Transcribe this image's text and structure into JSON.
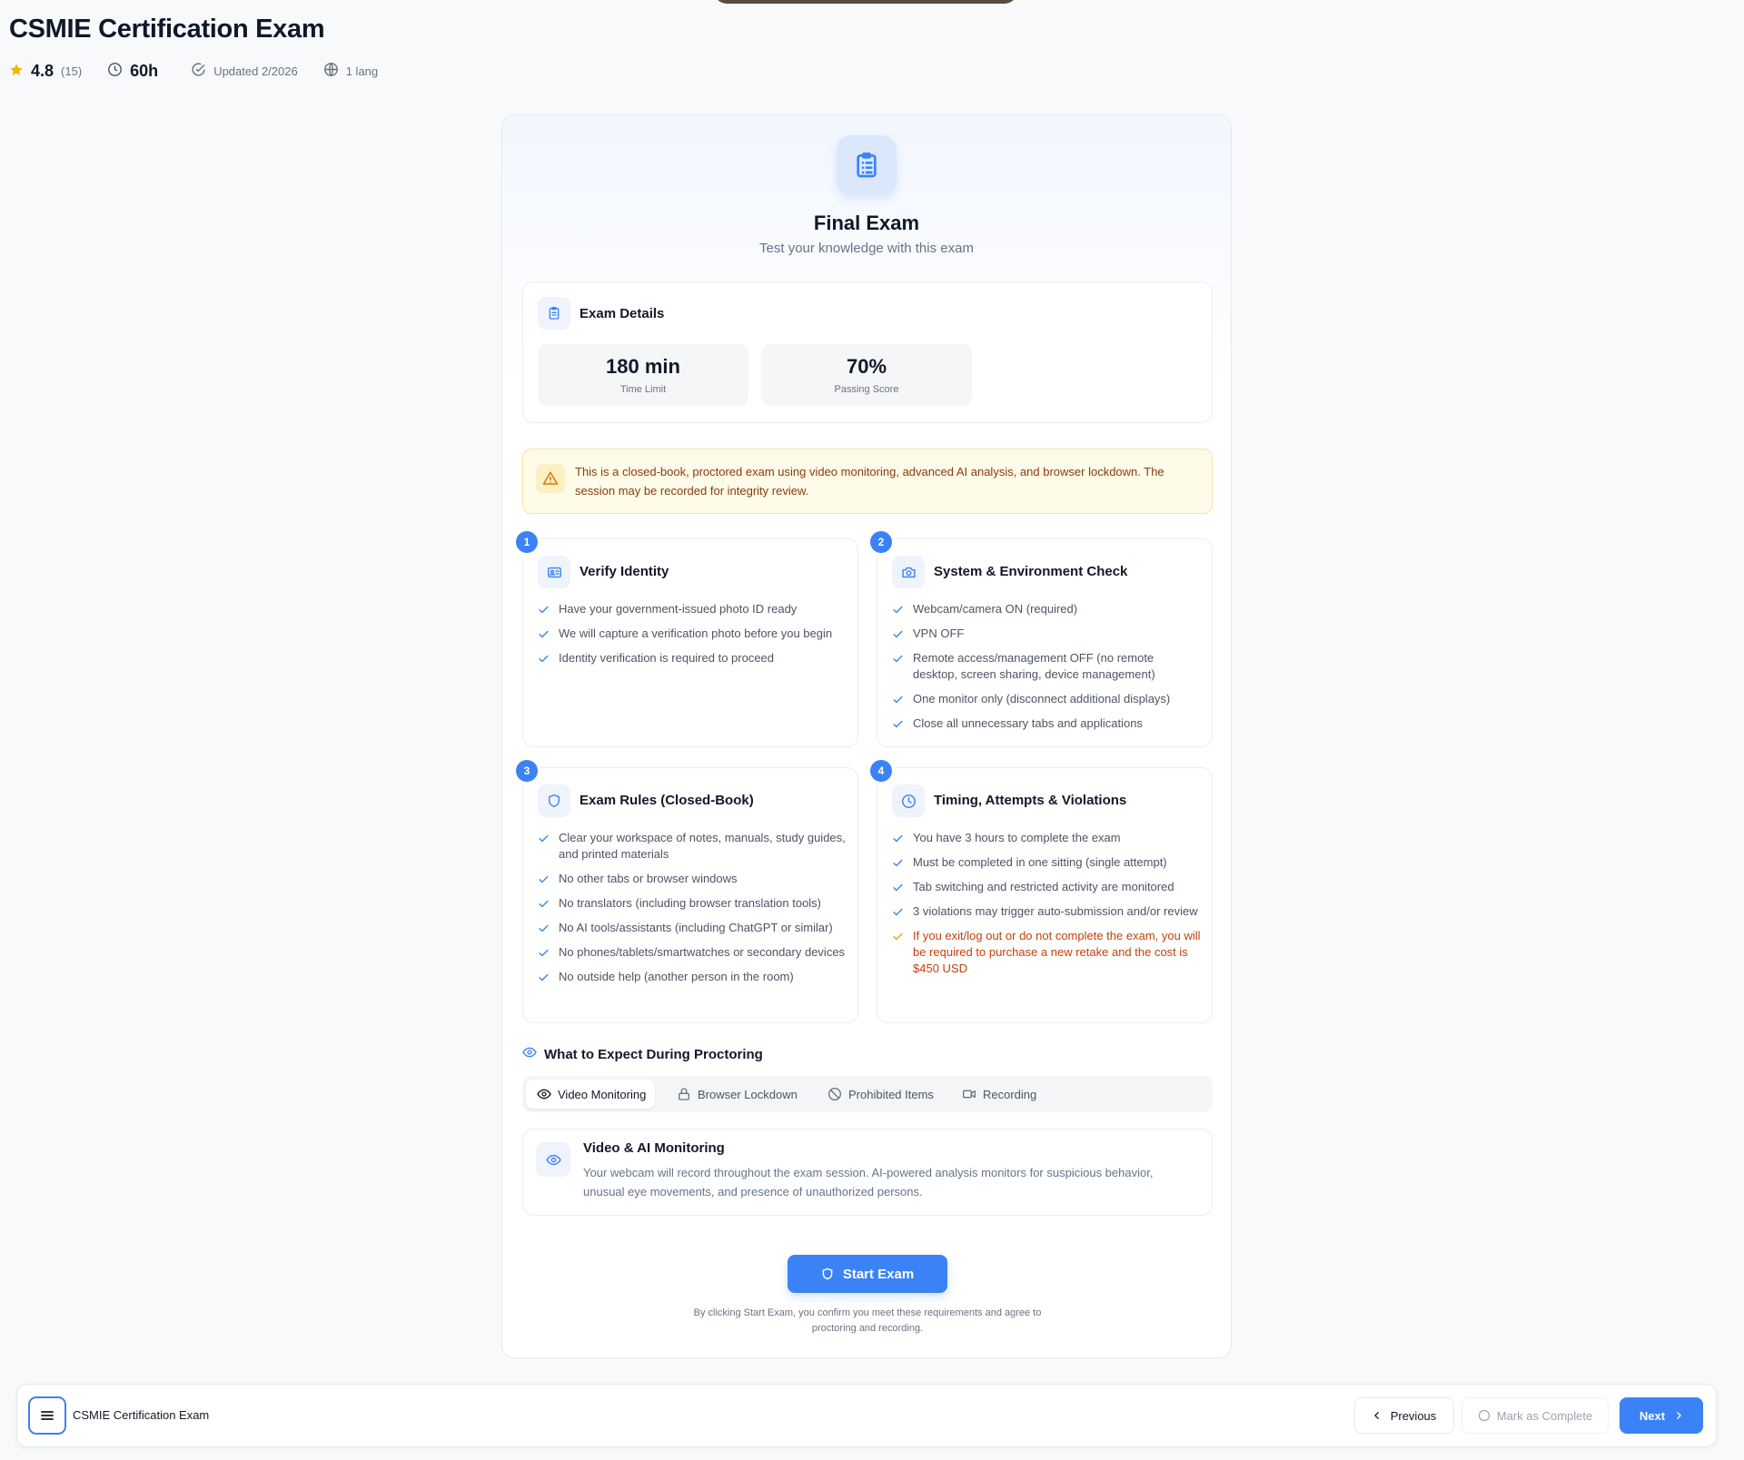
{
  "course": {
    "title": "CSMIE Certification Exam",
    "rating": "4.8",
    "rating_count": "(15)",
    "duration": "60h",
    "updated": "Updated 2/2026",
    "languages": "1 lang"
  },
  "exam": {
    "title": "Final Exam",
    "subtitle": "Test your knowledge with this exam",
    "details": {
      "heading": "Exam Details",
      "time_value": "180 min",
      "time_label": "Time Limit",
      "pass_value": "70%",
      "pass_label": "Passing Score"
    },
    "warning": "This is a closed-book, proctored exam using video monitoring, advanced AI analysis, and browser lockdown. The session may be recorded for integrity review.",
    "steps": [
      {
        "number": "1",
        "title": "Verify Identity",
        "items": [
          "Have your government-issued photo ID ready",
          "We will capture a verification photo before you begin",
          "Identity verification is required to proceed"
        ]
      },
      {
        "number": "2",
        "title": "System & Environment Check",
        "items": [
          "Webcam/camera ON (required)",
          "VPN OFF",
          "Remote access/management OFF (no remote desktop, screen sharing, device management)",
          "One monitor only (disconnect additional displays)",
          "Close all unnecessary tabs and applications"
        ]
      },
      {
        "number": "3",
        "title": "Exam Rules (Closed-Book)",
        "items": [
          "Clear your workspace of notes, manuals, study guides, and printed materials",
          "No other tabs or browser windows",
          "No translators (including browser translation tools)",
          "No AI tools/assistants (including ChatGPT or similar)",
          "No phones/tablets/smartwatches or secondary devices",
          "No outside help (another person in the room)"
        ]
      },
      {
        "number": "4",
        "title": "Timing, Attempts & Violations",
        "items": [
          "You have 3 hours to complete the exam",
          "Must be completed in one sitting (single attempt)",
          "Tab switching and restricted activity are monitored",
          "3 violations may trigger auto-submission and/or review",
          "If you exit/log out or do not complete the exam, you will be required to purchase a new retake and the cost is $450 USD"
        ]
      }
    ],
    "proctoring": {
      "heading": "What to Expect During Proctoring",
      "tabs": [
        "Video Monitoring",
        "Browser Lockdown",
        "Prohibited Items",
        "Recording"
      ],
      "active_tab": "Video Monitoring",
      "panel_title": "Video & AI Monitoring",
      "panel_text": "Your webcam will record throughout the exam session. AI-powered analysis monitors for suspicious behavior, unusual eye movements, and presence of unauthorized persons."
    },
    "start_label": "Start Exam",
    "disclaimer": "By clicking Start Exam, you confirm you meet these requirements and agree to proctoring and recording."
  },
  "bottom_bar": {
    "title": "CSMIE Certification Exam",
    "previous_label": "Previous",
    "mark_complete_label": "Mark as Complete",
    "next_label": "Next"
  },
  "colors": {
    "accent": "#3b82f6",
    "warning_bg": "#fefbe8",
    "warning_text": "#8a3b0c",
    "alert_orange": "#c2410c",
    "star": "#f5b400"
  },
  "icons": {
    "rating": "star-icon",
    "duration": "clock-icon",
    "updated": "check-circle-icon",
    "languages": "globe-icon",
    "exam": "clipboard-list-icon",
    "warning": "alert-triangle-icon",
    "step1": "id-card-icon",
    "step2": "camera-icon",
    "step3": "shield-icon",
    "step4": "clock-icon",
    "proctoring": "eye-icon"
  }
}
